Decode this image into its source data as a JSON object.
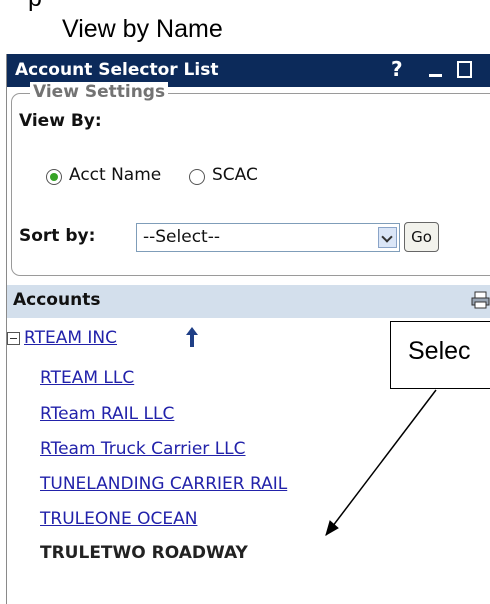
{
  "caption": {
    "line1": "p",
    "line2": "View by Name"
  },
  "window": {
    "title": "Account Selector List",
    "help_label": "?",
    "icons": {
      "help": "help-icon",
      "minimize": "minimize-icon",
      "maximize": "maximize-icon"
    },
    "title_bg": "#0c2a5a"
  },
  "view_settings": {
    "legend": "View Settings",
    "view_by_label": "View By:",
    "options": [
      {
        "label": "Acct Name",
        "checked": true
      },
      {
        "label": "SCAC",
        "checked": false
      }
    ],
    "sort_by_label": "Sort by:",
    "sort_select_value": "--Select--",
    "go_label": "Go"
  },
  "accounts": {
    "header": "Accounts",
    "print_icon": "printer-icon",
    "header_bg": "#d3dfec",
    "items": [
      {
        "label": "RTEAM INC",
        "link": true
      },
      {
        "label": "RTEAM LLC",
        "link": true
      },
      {
        "label": "RTeam RAIL LLC",
        "link": true
      },
      {
        "label": "RTeam Truck Carrier LLC",
        "link": true
      },
      {
        "label": "TUNELANDING CARRIER RAIL",
        "link": true
      },
      {
        "label": "TRULEONE OCEAN",
        "link": true
      },
      {
        "label": "TRULETWO ROADWAY",
        "link": false
      }
    ]
  },
  "callout": {
    "text": "Selec"
  }
}
